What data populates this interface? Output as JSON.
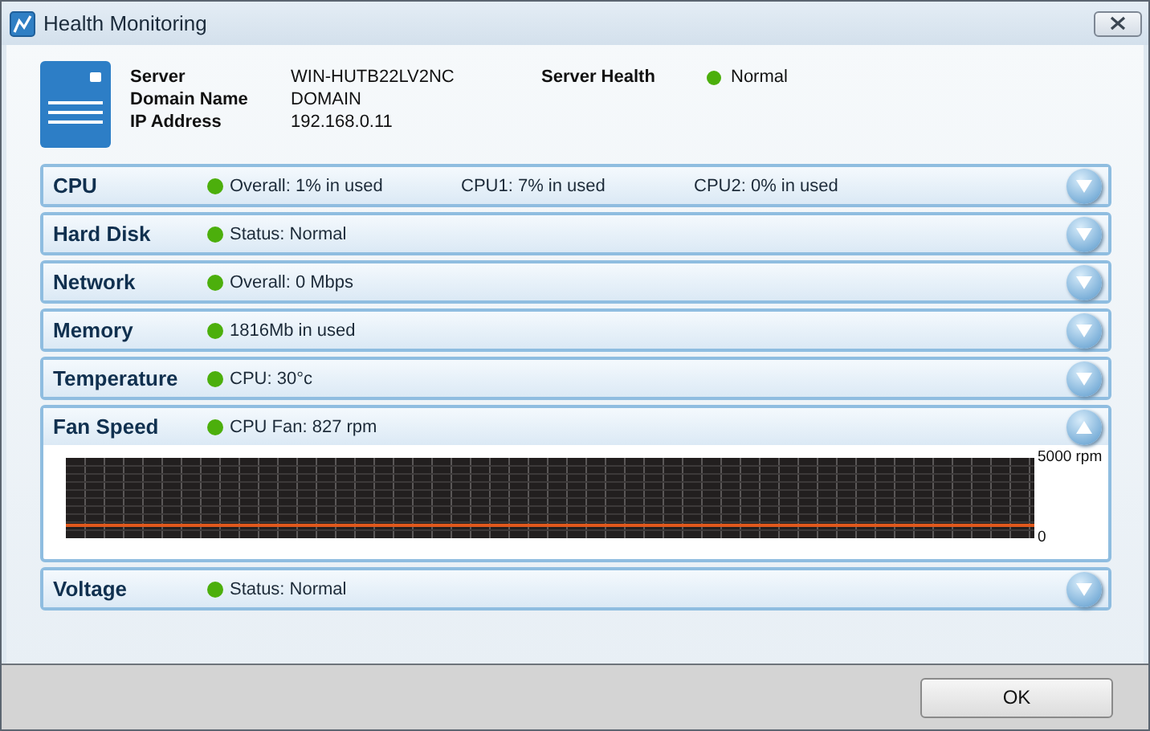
{
  "window": {
    "title": "Health Monitoring"
  },
  "server": {
    "fields": [
      {
        "label": "Server",
        "value": "WIN-HUTB22LV2NC"
      },
      {
        "label": "Domain Name",
        "value": "DOMAIN"
      },
      {
        "label": "IP Address",
        "value": "192.168.0.11"
      }
    ],
    "health": {
      "label": "Server Health",
      "value": "Normal",
      "color": "#4caf0c"
    }
  },
  "sections": [
    {
      "title": "CPU",
      "readings": [
        "Overall: 1% in used",
        "CPU1: 7% in used",
        "CPU2: 0% in used"
      ],
      "color": "#4caf0c",
      "expanded": false
    },
    {
      "title": "Hard Disk",
      "readings": [
        "Status: Normal"
      ],
      "color": "#4caf0c",
      "expanded": false
    },
    {
      "title": "Network",
      "readings": [
        "Overall: 0 Mbps"
      ],
      "color": "#4caf0c",
      "expanded": false
    },
    {
      "title": "Memory",
      "readings": [
        "1816Mb in used"
      ],
      "color": "#4caf0c",
      "expanded": false
    },
    {
      "title": "Temperature",
      "readings": [
        "CPU: 30°c"
      ],
      "color": "#4caf0c",
      "expanded": false
    },
    {
      "title": "Fan Speed",
      "readings": [
        "CPU Fan: 827 rpm"
      ],
      "color": "#4caf0c",
      "expanded": true,
      "chart_data": {
        "type": "line",
        "grid": true,
        "ylim": [
          0,
          5000
        ],
        "yticks": [
          {
            "value": 0,
            "label": "0"
          },
          {
            "value": 5000,
            "label": "5000 rpm"
          }
        ],
        "series": [
          {
            "color": "#e0581c",
            "values": [
              800,
              800,
              800,
              800,
              800,
              800,
              800,
              800,
              800,
              800,
              800,
              800,
              800,
              800,
              800,
              800,
              800,
              800,
              800,
              800,
              800,
              800,
              800,
              800,
              800,
              800,
              800,
              800,
              800,
              800,
              800,
              800,
              800,
              800,
              800,
              800,
              800,
              800,
              800,
              800,
              800,
              800,
              800,
              800,
              800,
              800,
              800,
              800,
              800,
              800
            ]
          }
        ]
      }
    },
    {
      "title": "Voltage",
      "readings": [
        "Status: Normal"
      ],
      "color": "#4caf0c",
      "expanded": false
    }
  ],
  "buttons": [
    "OK"
  ]
}
